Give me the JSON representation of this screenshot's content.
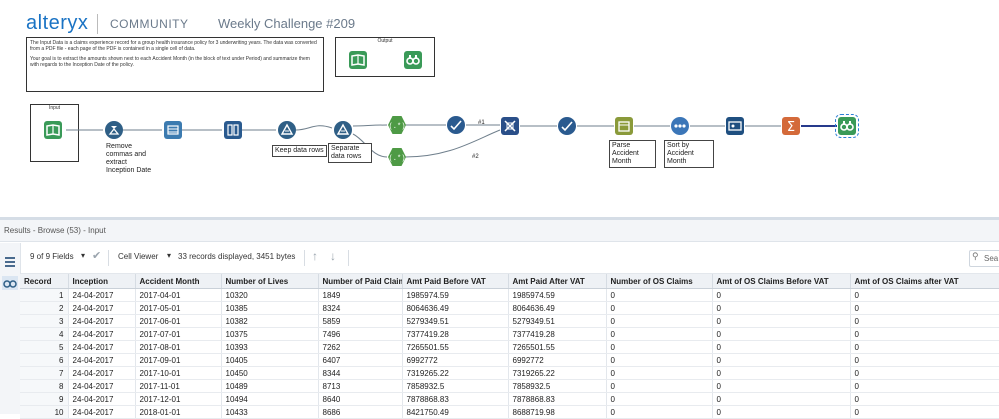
{
  "brand": {
    "logo_text": "alteryx",
    "community": "COMMUNITY",
    "challenge": "Weekly Challenge #209"
  },
  "comment": {
    "para1": "The Input Data is a claims experience record for a group health insurance policy for 3 underwriting years.  The data was converted from a PDF file - each page of the PDF is contained in a single cell of data.",
    "para2": "Your goal is to extract the amounts shown next to each Accident Month  (in the block of text under Period)  and summarize them with regards to the Inception Date of the policy."
  },
  "containers": {
    "output_title": "Output",
    "input_title": "Input"
  },
  "tools": {
    "formula1_label": "Remove commas and extract Inception Date",
    "filter1_label": "Keep data rows",
    "filter2_label": "Separate data rows",
    "connector1": "#1",
    "connector2": "#2",
    "datetime_label": "Parse Accident Month",
    "sort_label": "Sort by Accident Month"
  },
  "results": {
    "title": "Results - Browse (53) - Input"
  },
  "toolbar": {
    "fields": "9 of 9 Fields",
    "viewer": "Cell Viewer",
    "records": "33 records displayed, 3451 bytes",
    "search_placeholder": "Sea"
  },
  "table": {
    "columns": [
      "Record",
      "Inception",
      "Accident Month",
      "Number of Lives",
      "Number of Paid Claims",
      "Amt Paid Before VAT",
      "Amt Paid After VAT",
      "Number of OS Claims",
      "Amt of OS Claims Before VAT",
      "Amt of OS Claims after VAT"
    ],
    "rows": [
      [
        "1",
        "24-04-2017",
        "2017-04-01",
        "10320",
        "1849",
        "1985974.59",
        "1985974.59",
        "0",
        "0",
        "0"
      ],
      [
        "2",
        "24-04-2017",
        "2017-05-01",
        "10385",
        "8324",
        "8064636.49",
        "8064636.49",
        "0",
        "0",
        "0"
      ],
      [
        "3",
        "24-04-2017",
        "2017-06-01",
        "10382",
        "5859",
        "5279349.51",
        "5279349.51",
        "0",
        "0",
        "0"
      ],
      [
        "4",
        "24-04-2017",
        "2017-07-01",
        "10375",
        "7496",
        "7377419.28",
        "7377419.28",
        "0",
        "0",
        "0"
      ],
      [
        "5",
        "24-04-2017",
        "2017-08-01",
        "10393",
        "7262",
        "7265501.55",
        "7265501.55",
        "0",
        "0",
        "0"
      ],
      [
        "6",
        "24-04-2017",
        "2017-09-01",
        "10405",
        "6407",
        "6992772",
        "6992772",
        "0",
        "0",
        "0"
      ],
      [
        "7",
        "24-04-2017",
        "2017-10-01",
        "10450",
        "8344",
        "7319265.22",
        "7319265.22",
        "0",
        "0",
        "0"
      ],
      [
        "8",
        "24-04-2017",
        "2017-11-01",
        "10489",
        "8713",
        "7858932.5",
        "7858932.5",
        "0",
        "0",
        "0"
      ],
      [
        "9",
        "24-04-2017",
        "2017-12-01",
        "10494",
        "8640",
        "7878868.83",
        "7878868.83",
        "0",
        "0",
        "0"
      ],
      [
        "10",
        "24-04-2017",
        "2018-01-01",
        "10433",
        "8686",
        "8421750.49",
        "8688719.98",
        "0",
        "0",
        "0"
      ]
    ]
  },
  "colors": {
    "input": "#3a9a58",
    "formula": "#2f5f86",
    "multirow": "#3c7bb0",
    "filter": "#2f5f86",
    "regex": "#4e9a45",
    "transpose": "#2a4f89",
    "datetime": "#8a9a3a",
    "sort": "#3b76b8",
    "summarize": "#d46a3a",
    "browse": "#3a9a58"
  }
}
